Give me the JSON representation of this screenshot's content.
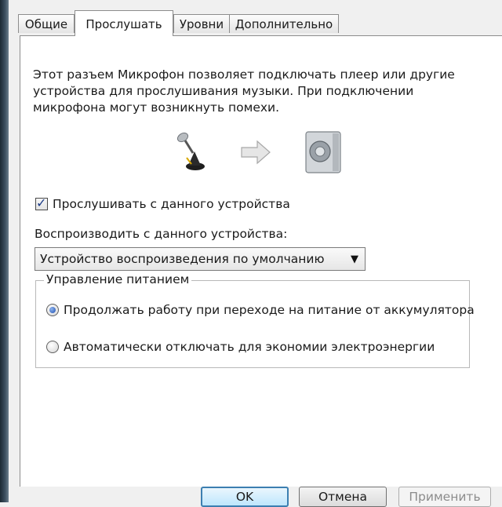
{
  "tabs": [
    {
      "label": "Общие",
      "active": false
    },
    {
      "label": "Прослушать",
      "active": true
    },
    {
      "label": "Уровни",
      "active": false
    },
    {
      "label": "Дополнительно",
      "active": false
    }
  ],
  "description": {
    "line1": "Этот разъем Микрофон позволяет подключать плеер или другие",
    "line2": "устройства для прослушивания музыки. При подключении",
    "line3": "микрофона могут возникнуть помехи."
  },
  "illustration": {
    "source_icon": "microphone-icon",
    "arrow_icon": "arrow-right-icon",
    "target_icon": "speaker-icon"
  },
  "listen_checkbox": {
    "label": "Прослушивать с данного устройства",
    "checked": true
  },
  "playback": {
    "label": "Воспроизводить с данного устройства:",
    "selected": "Устройство воспроизведения по умолчанию"
  },
  "power": {
    "legend": "Управление питанием",
    "options": [
      {
        "label": "Продолжать работу при переходе на питание от аккумулятора",
        "selected": true
      },
      {
        "label": "Автоматически отключать для экономии электроэнергии",
        "selected": false
      }
    ]
  },
  "buttons": {
    "ok": "OK",
    "cancel": "Отмена",
    "apply": "Применить"
  },
  "colors": {
    "accent": "#3c7fb1",
    "check": "#1b3a86",
    "radio_dot": "#1f4fb0"
  }
}
